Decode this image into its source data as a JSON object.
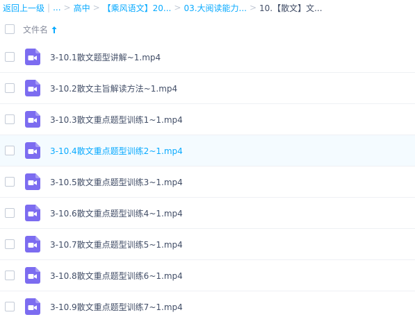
{
  "breadcrumb": {
    "back": "返回上一级",
    "ellipsis": "...",
    "crumbs": [
      "高中",
      "【乘风语文】20...",
      "03.大阅读能力..."
    ],
    "current": "10.【散文】文..."
  },
  "list_header": {
    "name_column": "文件名",
    "sort": "ascending"
  },
  "files": [
    {
      "name": "3-10.1散文题型讲解~1.mp4",
      "icon": "video-file-icon"
    },
    {
      "name": "3-10.2散文主旨解读方法~1.mp4",
      "icon": "video-file-icon"
    },
    {
      "name": "3-10.3散文重点题型训练1~1.mp4",
      "icon": "video-file-icon"
    },
    {
      "name": "3-10.4散文重点题型训练2~1.mp4",
      "icon": "video-file-icon",
      "highlighted": true
    },
    {
      "name": "3-10.5散文重点题型训练3~1.mp4",
      "icon": "video-file-icon"
    },
    {
      "name": "3-10.6散文重点题型训练4~1.mp4",
      "icon": "video-file-icon"
    },
    {
      "name": "3-10.7散文重点题型训练5~1.mp4",
      "icon": "video-file-icon"
    },
    {
      "name": "3-10.8散文重点题型训练6~1.mp4",
      "icon": "video-file-icon"
    },
    {
      "name": "3-10.9散文重点题型训练7~1.mp4",
      "icon": "video-file-icon"
    }
  ],
  "colors": {
    "link": "#09aaff",
    "text": "#424e67",
    "icon_purple": "#7c6cf0",
    "selected_row_bg": "#f4fbff"
  }
}
